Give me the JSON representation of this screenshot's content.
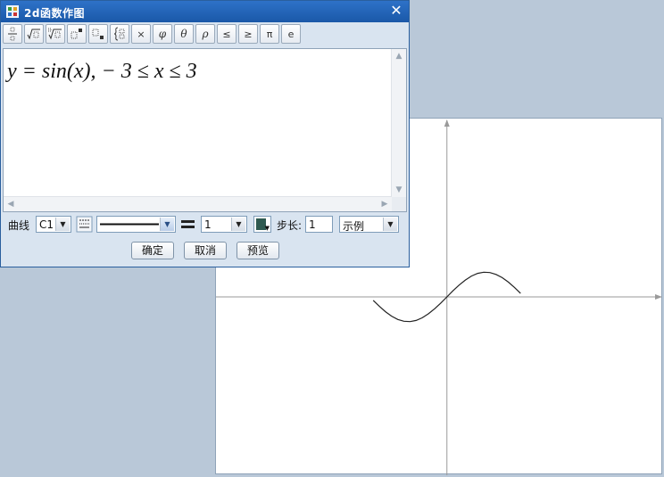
{
  "window": {
    "title": "2d函数作图",
    "close_glyph": "✕"
  },
  "toolbar": {
    "buttons": [
      {
        "name": "fraction-icon",
        "glyph": ""
      },
      {
        "name": "sqrt-icon",
        "glyph": ""
      },
      {
        "name": "nth-root-icon",
        "glyph": ""
      },
      {
        "name": "superscript-icon",
        "glyph": ""
      },
      {
        "name": "subscript-icon",
        "glyph": ""
      },
      {
        "name": "brace-icon",
        "glyph": "{}"
      },
      {
        "name": "times-icon",
        "glyph": "×"
      },
      {
        "name": "phi-icon",
        "glyph": "φ"
      },
      {
        "name": "theta-icon",
        "glyph": "θ"
      },
      {
        "name": "rho-icon",
        "glyph": "ρ"
      },
      {
        "name": "leq-icon",
        "glyph": "≤"
      },
      {
        "name": "geq-icon",
        "glyph": "≥"
      },
      {
        "name": "pi-icon",
        "glyph": "π"
      },
      {
        "name": "e-icon",
        "glyph": "e"
      }
    ]
  },
  "editor": {
    "formula": "y = sin(x),  − 3 ≤ x ≤ 3"
  },
  "options": {
    "curve_label": "曲线",
    "curve_value": "C1",
    "width_value": "1",
    "step_label": "步长:",
    "step_value": "1",
    "legend_value": "示例",
    "line_color": "#2f5a50"
  },
  "buttons": {
    "ok": "确定",
    "cancel": "取消",
    "preview": "预览"
  },
  "colors": {
    "titlebar": "#1a58a8",
    "dialog_bg": "#d9e4f0",
    "desktop_bg": "#b9c8d8",
    "axis": "#9a9a9a",
    "curve": "#222222"
  },
  "chart_data": {
    "type": "line",
    "series": [
      {
        "x": [
          -3,
          -2.75,
          -2.5,
          -2.25,
          -2,
          -1.75,
          -1.5,
          -1.25,
          -1,
          -0.75,
          -0.5,
          -0.25,
          0,
          0.25,
          0.5,
          0.75,
          1,
          1.25,
          1.5,
          1.75,
          2,
          2.25,
          2.5,
          2.75,
          3
        ],
        "y": [
          -0.141,
          -0.382,
          -0.598,
          -0.778,
          -0.909,
          -0.984,
          -0.997,
          -0.949,
          -0.841,
          -0.682,
          -0.479,
          -0.247,
          0,
          0.247,
          0.479,
          0.682,
          0.841,
          0.949,
          0.997,
          0.984,
          0.909,
          0.778,
          0.598,
          0.382,
          0.141
        ]
      }
    ],
    "xlim": [
      -9.4,
      8.8
    ],
    "ylim": [
      -7.2,
      7.2
    ],
    "grid": false
  }
}
